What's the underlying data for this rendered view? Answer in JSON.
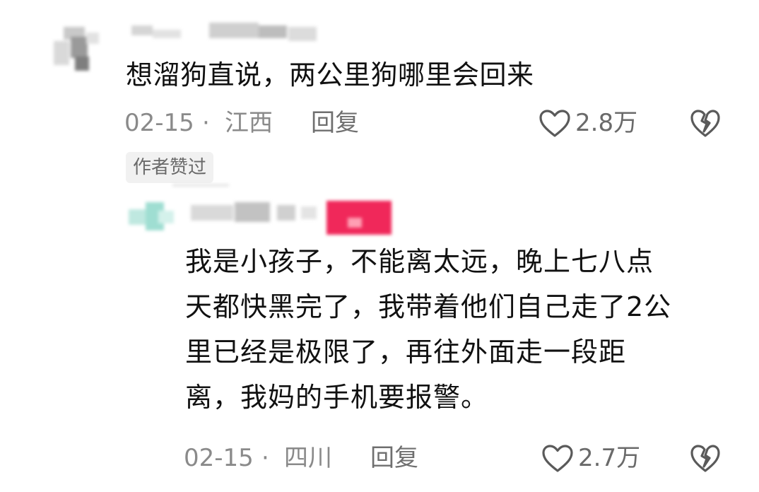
{
  "comment_1": {
    "text": "想溜狗直说，两公里狗哪里会回来",
    "date": "02-15",
    "separator": "·",
    "location": "江西",
    "reply_label": "回复",
    "like_count": "2.8万",
    "author_badge": "作者赞过"
  },
  "comment_2": {
    "lines": [
      "我是小孩子，不能离太远，晚上七八点",
      "天都快黑完了，我带着他们自己走了2公",
      "里已经是极限了，再往外面走一段距",
      "离，我妈的手机要报警。"
    ],
    "date": "02-15",
    "separator": "·",
    "location": "四川",
    "reply_label": "回复",
    "like_count": "2.7万"
  },
  "icons": {
    "like": "heart-outline-icon",
    "dislike": "broken-heart-icon"
  },
  "colors": {
    "text_primary": "#111111",
    "text_secondary": "#8a8a8a",
    "badge_bg": "#f1f1f1",
    "tag_pink": "#f0285a"
  }
}
